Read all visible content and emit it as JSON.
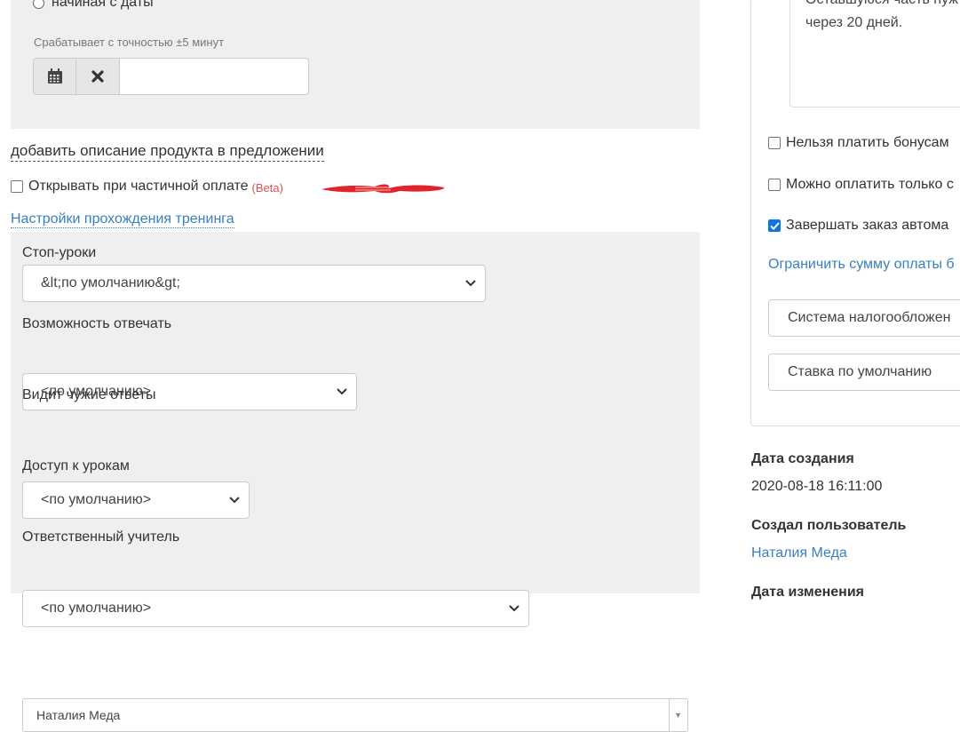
{
  "schedule": {
    "radio_label": "начиная с даты",
    "hint": "Срабатывает с точностью ±5 минут",
    "date_value": ""
  },
  "offer": {
    "description_link": "добавить описание продукта в предложении",
    "partial_payment_label": "Открывать при частичной оплате",
    "partial_payment_checked": false,
    "beta_badge": "(Beta)"
  },
  "training": {
    "settings_link": "Настройки прохождения тренинга",
    "stop_lessons_label": "Стоп-уроки",
    "stop_lessons_value": "&lt;по умолчанию&gt;",
    "can_answer_label": "Возможность отвечать",
    "can_answer_value": "<по умолчанию>",
    "sees_others_label": "Видит чужие ответы",
    "sees_others_value": "<по умолчанию>",
    "lessons_access_label": "Доступ к урокам",
    "lessons_access_value": "<по умолчанию>",
    "teacher_label": "Ответственный учитель",
    "teacher_value": "Наталия Меда"
  },
  "right_panel": {
    "textarea_line1": "Оставшуюся часть нуж",
    "textarea_line2": "через 20 дней.",
    "no_bonus_label": "Нельзя платить бонусам",
    "no_bonus_checked": false,
    "only_pay_label": "Можно оплатить только с",
    "only_pay_checked": false,
    "auto_complete_label": "Завершать заказ автома",
    "auto_complete_checked": true,
    "limit_link": "Ограничить сумму оплаты б",
    "tax_system_placeholder": "Система налогообложен",
    "default_rate_placeholder": "Ставка по умолчанию"
  },
  "meta": {
    "created_label": "Дата создания",
    "created_value": "2020-08-18 16:11:00",
    "creator_label": "Создал пользователь",
    "creator_value": "Наталия Меда",
    "modified_label": "Дата изменения"
  },
  "colors": {
    "panel_bg": "#efefef",
    "link": "#3a7fc0",
    "beta": "#d9534f",
    "annotation": "#e0242a",
    "checkbox_checked": "#0f73e6"
  }
}
